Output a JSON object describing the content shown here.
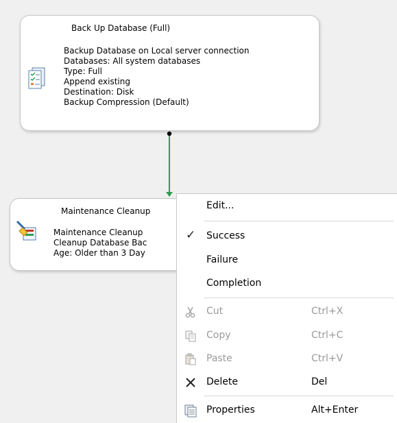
{
  "colors": {
    "canvas": "#f0f0f0",
    "connector_success": "#2e9e4f",
    "disabled_text": "#9a9a9a"
  },
  "tasks": [
    {
      "title": "Back Up Database (Full)",
      "icon": "backup-task-icon",
      "lines": [
        "Backup Database on Local server connection",
        "Databases: All system databases",
        "Type: Full",
        "Append existing",
        "Destination: Disk",
        "Backup Compression (Default)"
      ]
    },
    {
      "title": "Maintenance Cleanup",
      "icon": "cleanup-task-icon",
      "lines": [
        "Maintenance Cleanup",
        "Cleanup Database Bac",
        "Age: Older than 3 Day"
      ]
    }
  ],
  "context_menu": {
    "edit": "Edit...",
    "success": "Success",
    "failure": "Failure",
    "completion": "Completion",
    "cut": {
      "label": "Cut",
      "shortcut": "Ctrl+X",
      "icon": "scissors-icon"
    },
    "copy": {
      "label": "Copy",
      "shortcut": "Ctrl+C",
      "icon": "copy-icon"
    },
    "paste": {
      "label": "Paste",
      "shortcut": "Ctrl+V",
      "icon": "paste-icon"
    },
    "delete": {
      "label": "Delete",
      "shortcut": "Del",
      "icon": "delete-x-icon"
    },
    "properties": {
      "label": "Properties",
      "shortcut": "Alt+Enter",
      "icon": "properties-icon"
    },
    "checked_item": "Success"
  }
}
